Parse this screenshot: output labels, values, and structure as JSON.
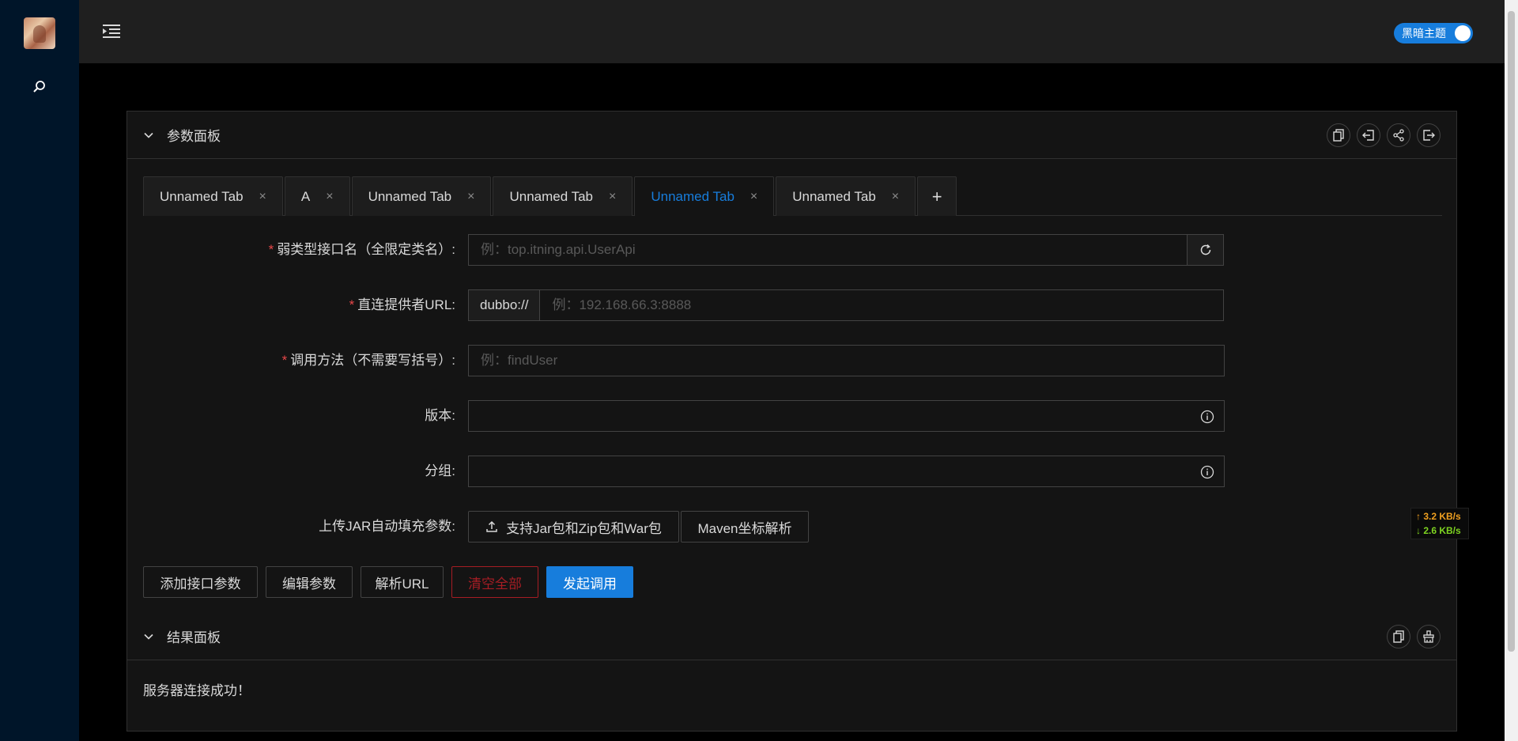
{
  "header": {
    "theme_toggle_label": "黑暗主题"
  },
  "params_panel": {
    "title": "参数面板",
    "tabs": [
      {
        "label": "Unnamed Tab",
        "active": false
      },
      {
        "label": "A",
        "active": false
      },
      {
        "label": "Unnamed Tab",
        "active": false
      },
      {
        "label": "Unnamed Tab",
        "active": false
      },
      {
        "label": "Unnamed Tab",
        "active": true
      },
      {
        "label": "Unnamed Tab",
        "active": false
      }
    ],
    "add_tab_label": "+",
    "close_glyph": "×",
    "form": {
      "interface_label": "弱类型接口名（全限定类名）:",
      "interface_placeholder": "例：top.itning.api.UserApi",
      "interface_value": "",
      "url_label": "直连提供者URL:",
      "url_prefix": "dubbo://",
      "url_placeholder": "例：192.168.66.3:8888",
      "url_value": "",
      "method_label": "调用方法（不需要写括号）:",
      "method_placeholder": "例：findUser",
      "method_value": "",
      "version_label": "版本:",
      "version_value": "",
      "group_label": "分组:",
      "group_value": "",
      "upload_label": "上传JAR自动填充参数:",
      "upload_button": "支持Jar包和Zip包和War包",
      "maven_button": "Maven坐标解析"
    },
    "actions": {
      "add_params": "添加接口参数",
      "edit_params": "编辑参数",
      "parse_url": "解析URL",
      "clear_all": "清空全部",
      "invoke": "发起调用"
    }
  },
  "result_panel": {
    "title": "结果面板",
    "message": "服务器连接成功！"
  },
  "net_speed": {
    "up": "↑ 3.2 KB/s",
    "down": "↓ 2.6 KB/s"
  },
  "colors": {
    "accent": "#177ddc",
    "danger": "#a61d24",
    "sidebar": "#001529",
    "upload_speed": "#f0a020",
    "download_speed": "#7ed321"
  },
  "icons": [
    "search-icon",
    "menu-fold-icon",
    "chevron-down-icon",
    "copy-icon",
    "import-icon",
    "share-icon",
    "export-icon",
    "reload-icon",
    "info-icon",
    "upload-icon",
    "clear-icon"
  ]
}
